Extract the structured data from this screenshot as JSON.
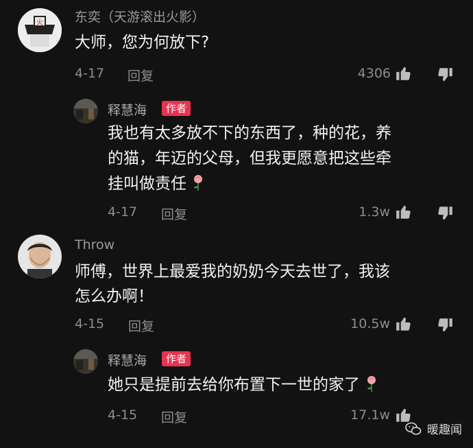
{
  "comments": [
    {
      "username": "东奕（天游滚出火影）",
      "text": [
        "大师，您为何放下?"
      ],
      "date": "4-17",
      "reply_label": "回复",
      "likes": "4306",
      "replies": [
        {
          "username": "释慧海",
          "badge": "作者",
          "text": [
            "我也有太多放不下的东西了，种的花，养",
            "的猫，年迈的父母，但我更愿意把这些牵",
            "挂叫做责任"
          ],
          "date": "4-17",
          "reply_label": "回复",
          "likes": "1.3w"
        }
      ]
    },
    {
      "username": "Throw",
      "text": [
        "师傅，世界上最爱我的奶奶今天去世了，我该",
        "怎么办啊！"
      ],
      "date": "4-15",
      "reply_label": "回复",
      "likes": "10.5w",
      "replies": [
        {
          "username": "释慧海",
          "badge": "作者",
          "text": [
            "她只是提前去给你布置下一世的家了"
          ],
          "date": "4-15",
          "reply_label": "回复",
          "likes": "17.1w"
        }
      ]
    }
  ],
  "watermark": "暖趣闻",
  "colors": {
    "background": "#121212",
    "badge": "#e8334f",
    "muted": "#8d8d8d"
  },
  "icons": {
    "like": "thumbs-up-icon",
    "dislike": "thumbs-down-icon",
    "rose": "rose-emoji"
  }
}
